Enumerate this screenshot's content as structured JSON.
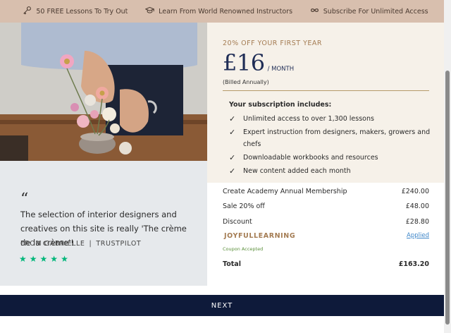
{
  "topbar": {
    "items": [
      {
        "icon": "key-icon",
        "label": "50 FREE Lessons To Try Out"
      },
      {
        "icon": "graduation-cap-icon",
        "label": "Learn From World Renowned Instructors"
      },
      {
        "icon": "infinity-icon",
        "label": "Subscribe For Unlimited Access"
      }
    ]
  },
  "testimonial": {
    "quote_mark": "“",
    "text": "The selection of interior designers and creatives on this site is really 'The crème de la crème'!",
    "author": "FROM GABRIELLE",
    "separator": "|",
    "source": "TRUSTPILOT",
    "rating": 5,
    "star": "★"
  },
  "offer": {
    "promo": "20% OFF YOUR FIRST YEAR",
    "price": "£16",
    "per": "/ MONTH",
    "billed": "(Billed Annually)"
  },
  "includes": {
    "title": "Your subscription includes:",
    "check": "✓",
    "features": [
      "Unlimited access to over 1,300 lessons",
      "Expert instruction from designers, makers, growers and chefs",
      "Downloadable workbooks and resources",
      "New content added each month"
    ]
  },
  "summary": {
    "membership_label": "Create Academy Annual Membership",
    "membership_value": "£240.00",
    "sale_label": "Sale 20% off",
    "sale_value": "£48.00",
    "discount_label": "Discount",
    "discount_value": "£28.80",
    "coupon_code": "JOYFULLEARNING",
    "coupon_status": "Applied",
    "coupon_accepted": "Coupon Accepted",
    "total_label": "Total",
    "total_value": "£163.20"
  },
  "next_label": "NEXT",
  "colors": {
    "topbar": "#d8bfae",
    "navy": "#0e1a3a",
    "price": "#1f2d56",
    "gold": "#a47c53",
    "star": "#00b67a",
    "link": "#3e86c9"
  }
}
